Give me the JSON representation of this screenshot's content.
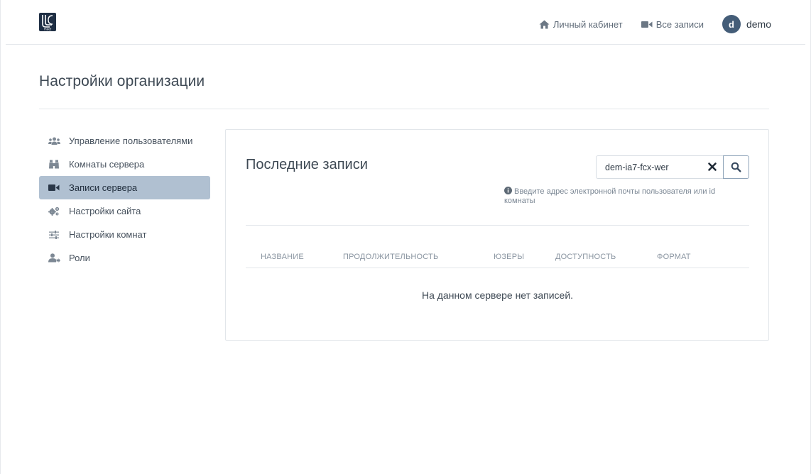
{
  "header": {
    "logo_text": "meet",
    "nav": [
      {
        "label": "Личный кабинет",
        "icon": "home-icon"
      },
      {
        "label": "Все записи",
        "icon": "video-camera-icon"
      }
    ],
    "user": {
      "initial": "d",
      "name": "demo"
    }
  },
  "page": {
    "title": "Настройки организации"
  },
  "sidebar": {
    "items": [
      {
        "label": "Управление пользователями",
        "icon": "users-icon",
        "active": false
      },
      {
        "label": "Комнаты сервера",
        "icon": "binoculars-icon",
        "active": false
      },
      {
        "label": "Записи сервера",
        "icon": "video-camera-icon",
        "active": true
      },
      {
        "label": "Настройки сайта",
        "icon": "cogs-icon",
        "active": false
      },
      {
        "label": "Настройки комнат",
        "icon": "sliders-icon",
        "active": false
      },
      {
        "label": "Роли",
        "icon": "user-roles-icon",
        "active": false
      }
    ]
  },
  "recordings": {
    "title": "Последние записи",
    "search": {
      "value": "dem-ia7-fcx-wer",
      "placeholder": ""
    },
    "hint": "Введите адрес электронной почты пользователя или id комнаты",
    "columns": [
      "НАЗВАНИЕ",
      "ПРОДОЛЖИТЕЛЬНОСТЬ",
      "ЮЗЕРЫ",
      "ДОСТУПНОСТЬ",
      "ФОРМАТ"
    ],
    "empty_message": "На данном сервере нет записей."
  },
  "colors": {
    "active_sidebar": "#b0c0d1",
    "avatar": "#445d78",
    "logo_bg": "#1f2f44",
    "text": "#3e4954"
  }
}
